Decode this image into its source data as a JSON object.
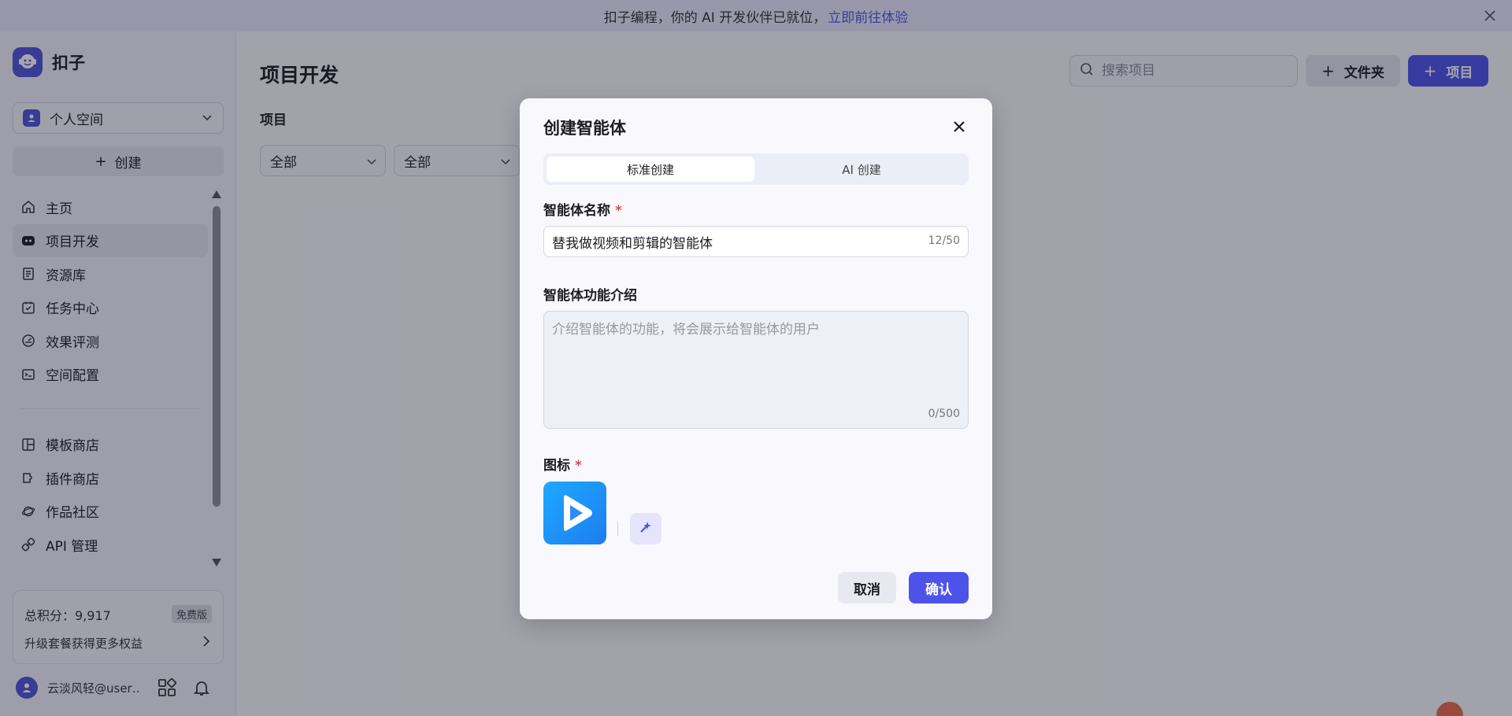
{
  "banner": {
    "text": "扣子编程，你的 AI 开发伙伴已就位，",
    "link": "立即前往体验"
  },
  "sidebar": {
    "app_name": "扣子",
    "space": "个人空间",
    "create_label": "创建",
    "nav_primary": [
      {
        "label": "主页",
        "icon": "home-icon"
      },
      {
        "label": "项目开发",
        "icon": "robot-icon",
        "active": true
      },
      {
        "label": "资源库",
        "icon": "library-icon"
      },
      {
        "label": "任务中心",
        "icon": "task-icon"
      },
      {
        "label": "效果评测",
        "icon": "evaluation-icon"
      },
      {
        "label": "空间配置",
        "icon": "settings-icon"
      }
    ],
    "nav_secondary": [
      {
        "label": "模板商店",
        "icon": "template-icon"
      },
      {
        "label": "插件商店",
        "icon": "plugin-icon"
      },
      {
        "label": "作品社区",
        "icon": "community-icon"
      },
      {
        "label": "API 管理",
        "icon": "api-icon"
      }
    ],
    "points_label": "总积分：9,917",
    "plan_badge": "免费版",
    "upgrade_label": "升级套餐获得更多权益",
    "user_name": "云淡风轻@user…"
  },
  "main": {
    "page_title": "项目开发",
    "section_label": "项目",
    "filters": [
      "全部",
      "全部"
    ],
    "search_placeholder": "搜索项目",
    "folder_button": "文件夹",
    "project_button": "项目"
  },
  "modal": {
    "title": "创建智能体",
    "tabs": [
      "标准创建",
      "AI 创建"
    ],
    "active_tab": 0,
    "name_label": "智能体名称",
    "name_value": "替我做视频和剪辑的智能体",
    "name_counter": "12/50",
    "desc_label": "智能体功能介绍",
    "desc_placeholder": "介绍智能体的功能，将会展示给智能体的用户",
    "desc_counter": "0/500",
    "icon_label": "图标",
    "required_mark": "*",
    "cancel": "取消",
    "confirm": "确认"
  },
  "colors": {
    "accent": "#4d53e8",
    "required": "#e5483d",
    "agent_icon": "#1fa8ff"
  }
}
